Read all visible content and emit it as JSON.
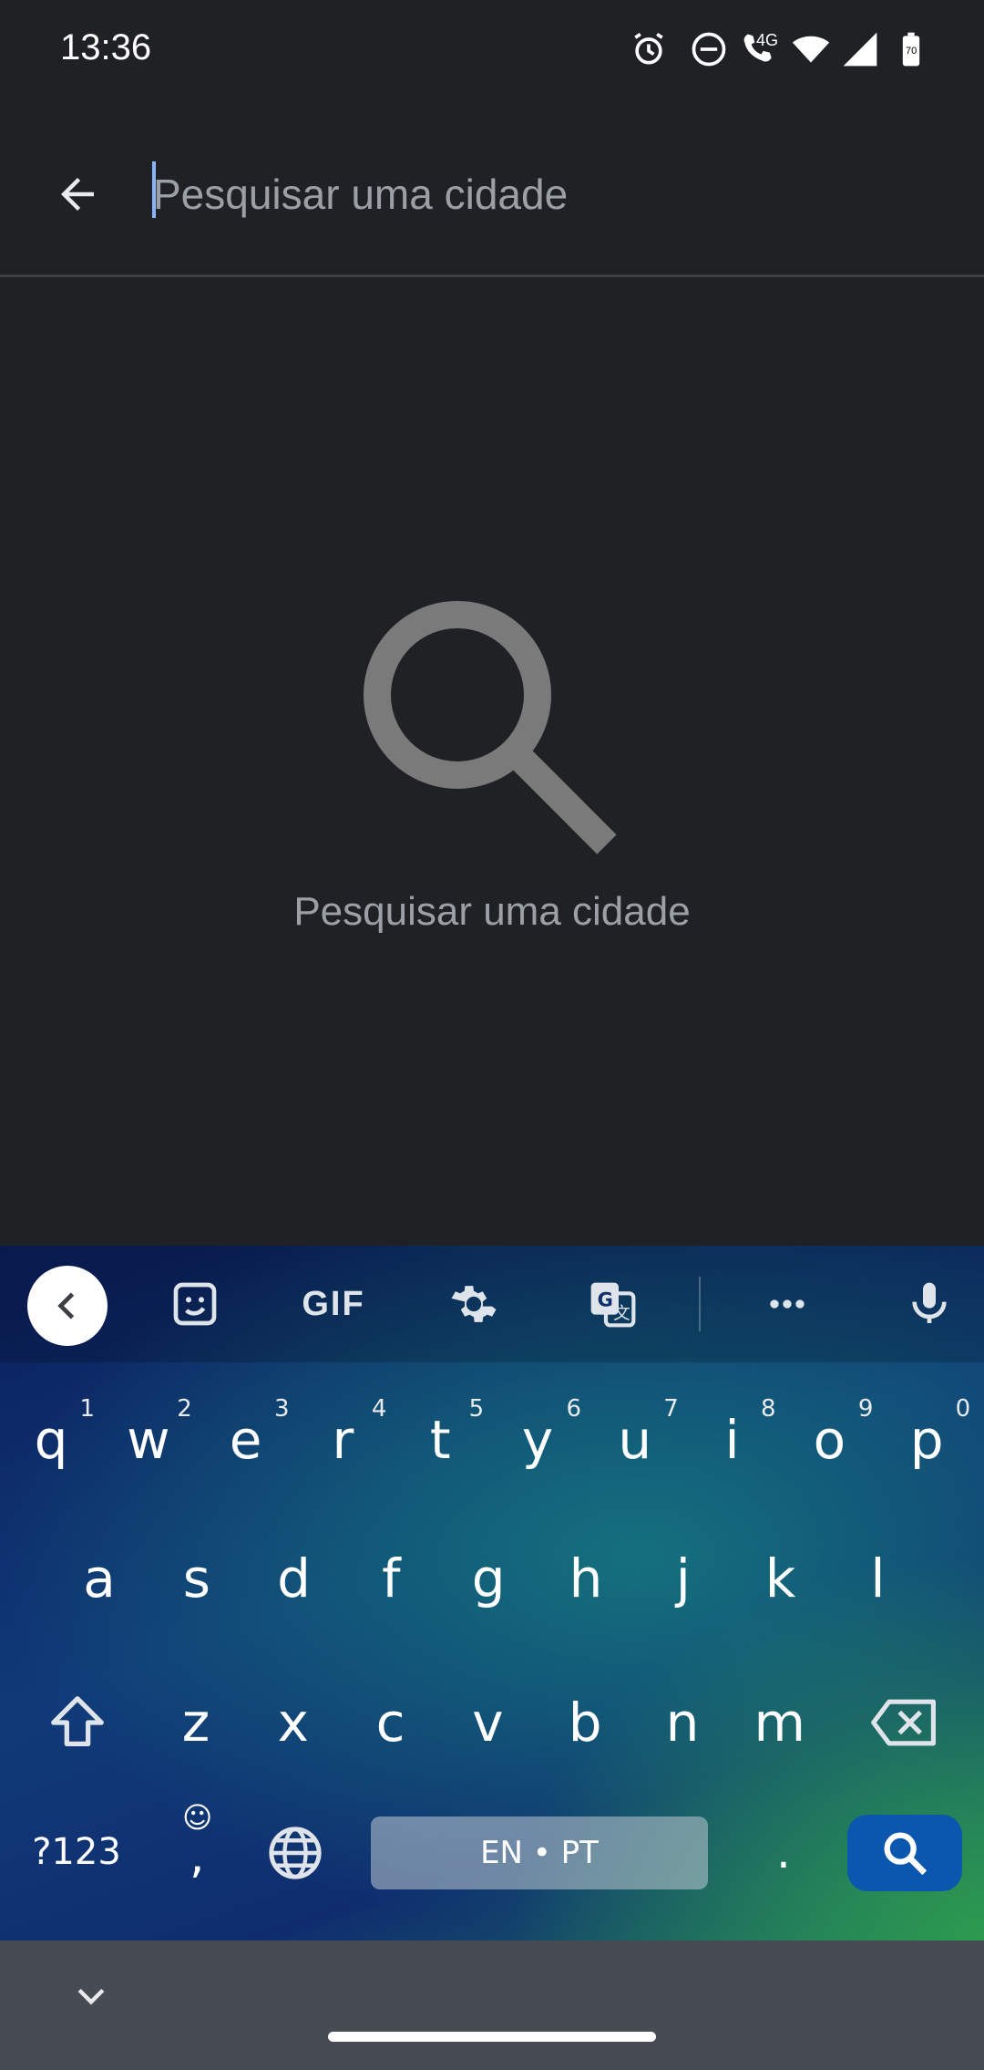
{
  "status_bar": {
    "time": "13:36",
    "icons": [
      "alarm-icon",
      "do-not-disturb-icon",
      "volte-call-icon",
      "wifi-icon",
      "signal-icon",
      "battery-icon"
    ],
    "network_label": "4G",
    "battery_level": "70"
  },
  "search": {
    "placeholder": "Pesquisar uma cidade",
    "value": ""
  },
  "empty_state": {
    "icon": "search-icon",
    "message": "Pesquisar uma cidade"
  },
  "keyboard": {
    "toolbar": [
      "collapse-icon",
      "sticker-icon",
      "gif-button",
      "settings-icon",
      "translate-icon",
      "more-icon",
      "microphone-icon"
    ],
    "gif_label": "GIF",
    "row1": [
      {
        "key": "q",
        "hint": "1"
      },
      {
        "key": "w",
        "hint": "2"
      },
      {
        "key": "e",
        "hint": "3"
      },
      {
        "key": "r",
        "hint": "4"
      },
      {
        "key": "t",
        "hint": "5"
      },
      {
        "key": "y",
        "hint": "6"
      },
      {
        "key": "u",
        "hint": "7"
      },
      {
        "key": "i",
        "hint": "8"
      },
      {
        "key": "o",
        "hint": "9"
      },
      {
        "key": "p",
        "hint": "0"
      }
    ],
    "row2": [
      "a",
      "s",
      "d",
      "f",
      "g",
      "h",
      "j",
      "k",
      "l"
    ],
    "row3": [
      "z",
      "x",
      "c",
      "v",
      "b",
      "n",
      "m"
    ],
    "symbols_label": "?123",
    "comma_label": ",",
    "emoji_hint": "☺",
    "space_label": "EN • PT",
    "period_label": ".",
    "colors": {
      "search_key": "#0b57b0",
      "space_key": "#aebbc6"
    }
  },
  "colors": {
    "background": "#202124",
    "accent": "#8ab4f8",
    "nav_bar": "#474c52"
  }
}
